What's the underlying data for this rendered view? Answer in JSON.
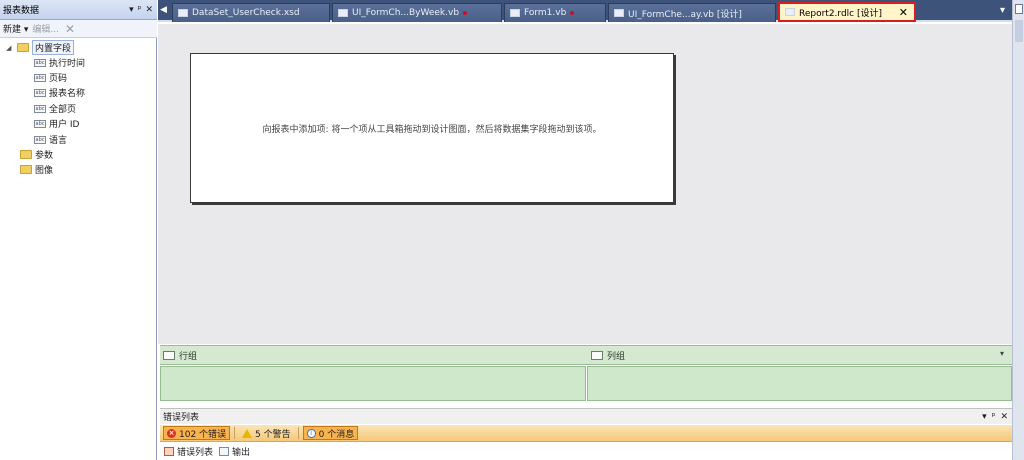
{
  "left_panel": {
    "title": "报表数据",
    "controls": {
      "dropdown": "▾",
      "pin": "ᵖ",
      "close": "✕"
    },
    "toolbar": {
      "new_label": "新建 ▾",
      "edit_label": "编辑...",
      "delete_symbol": "✕"
    },
    "tree": {
      "builtin_fields": {
        "label": "内置字段",
        "items": [
          "执行时间",
          "页码",
          "报表名称",
          "全部页",
          "用户 ID",
          "语言"
        ]
      },
      "parameters_label": "参数",
      "images_label": "图像"
    }
  },
  "tabs": [
    {
      "label": "DataSet_UserCheck.xsd",
      "modified": false
    },
    {
      "label": "UI_FormCh...ByWeek.vb",
      "modified": true
    },
    {
      "label": "Form1.vb",
      "modified": true
    },
    {
      "label": "UI_FormChe...ay.vb [设计]",
      "modified": false
    },
    {
      "label": "Report2.rdlc [设计]",
      "modified": false,
      "active": true
    }
  ],
  "design": {
    "hint": "向报表中添加项: 将一个项从工具箱拖动到设计图面，然后将数据集字段拖动到该项。"
  },
  "grouping": {
    "row_groups_label": "行组",
    "column_groups_label": "列组",
    "dropdown": "▾"
  },
  "error_list": {
    "title": "错误列表",
    "controls": {
      "dropdown": "▾",
      "pin": "ᵖ",
      "close": "✕"
    },
    "errors": "102 个错误",
    "warnings": "5 个警告",
    "messages": "0 个消息"
  },
  "bottom_tabs": {
    "errors_tab": "错误列表",
    "output_tab": "输出"
  },
  "colors": {
    "accent_tab_border": "#d81f1f",
    "tab_strip": "#3e5379",
    "group_green": "#d5e8d0"
  }
}
